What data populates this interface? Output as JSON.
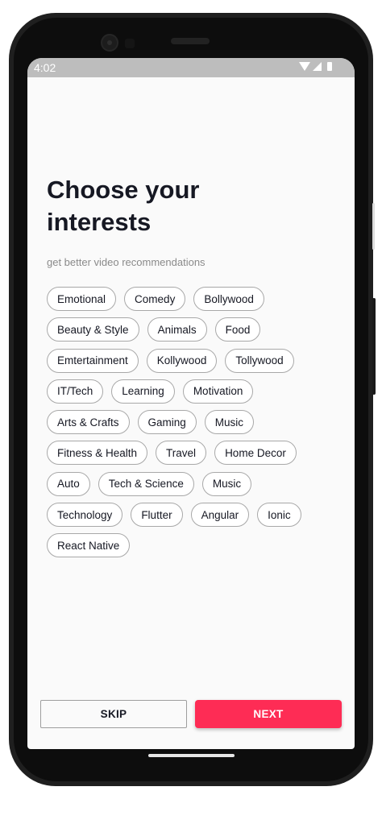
{
  "status_bar": {
    "time": "4:02",
    "icons": [
      "wifi-icon",
      "cell-signal-icon",
      "battery-icon"
    ]
  },
  "header": {
    "title": "Choose your interests",
    "subtitle": "get better video recommendations"
  },
  "interests": [
    "Emotional",
    "Comedy",
    "Bollywood",
    "Beauty & Style",
    "Animals",
    "Food",
    "Emtertainment",
    "Kollywood",
    "Tollywood",
    "IT/Tech",
    "Learning",
    "Motivation",
    "Arts & Crafts",
    "Gaming",
    "Music",
    "Fitness & Health",
    "Travel",
    "Home Decor",
    "Auto",
    "Tech & Science",
    "Music",
    "Technology",
    "Flutter",
    "Angular",
    "Ionic",
    "React Native"
  ],
  "actions": {
    "skip_label": "SKIP",
    "next_label": "NEXT"
  },
  "colors": {
    "accent": "#fe2c55",
    "status_bar": "#bdbdbd",
    "text": "#161823"
  }
}
